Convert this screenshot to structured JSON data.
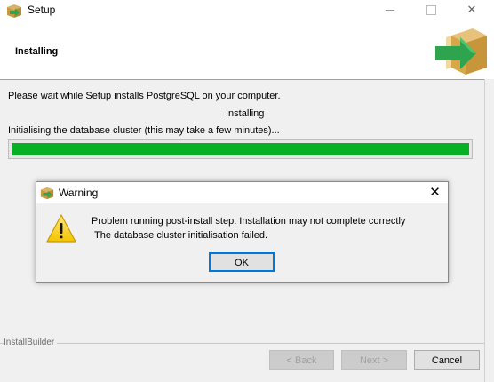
{
  "window": {
    "title": "Setup",
    "title_icon": "installer-box-icon"
  },
  "header": {
    "page_title": "Installing",
    "logo_icon": "installer-box-arrow-icon"
  },
  "body": {
    "wait_text": "Please wait while Setup installs PostgreSQL on your computer.",
    "status_text": "Installing",
    "step_text": "Initialising the database cluster (this may take a few minutes)...",
    "progress_percent": 100,
    "progress_color": "#06b025"
  },
  "footer": {
    "brand": "InstallBuilder",
    "back_label": "< Back",
    "next_label": "Next >",
    "cancel_label": "Cancel"
  },
  "dialog": {
    "title": "Warning",
    "close_glyph": "✕",
    "message_line1": "Problem running post-install step. Installation may not complete correctly",
    "message_line2": " The database cluster initialisation failed.",
    "ok_label": "OK",
    "ok_border_color": "#0078d7"
  }
}
